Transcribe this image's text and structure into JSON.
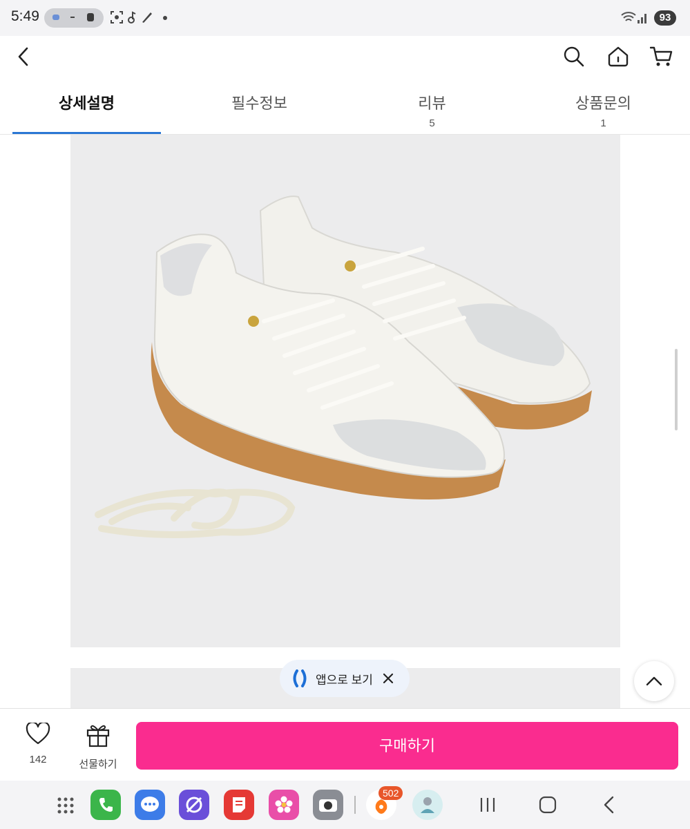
{
  "status_bar": {
    "time": "5:49",
    "battery": "93"
  },
  "header": {
    "back_icon": "chevron-left-icon",
    "search_icon": "search-icon",
    "home_icon": "home-icon",
    "cart_icon": "cart-icon"
  },
  "tabs": [
    {
      "label": "상세설명",
      "count": ""
    },
    {
      "label": "필수정보",
      "count": ""
    },
    {
      "label": "리뷰",
      "count": "5"
    },
    {
      "label": "상품문의",
      "count": "1"
    }
  ],
  "app_banner": {
    "label": "앱으로 보기"
  },
  "bottom_bar": {
    "wish_count": "142",
    "gift_label": "선물하기",
    "buy_label": "구매하기",
    "buy_color": "#fa2c8f"
  },
  "dock": {
    "badge": "502"
  },
  "colors": {
    "accent": "#2a77d4",
    "buy": "#fa2c8f"
  }
}
